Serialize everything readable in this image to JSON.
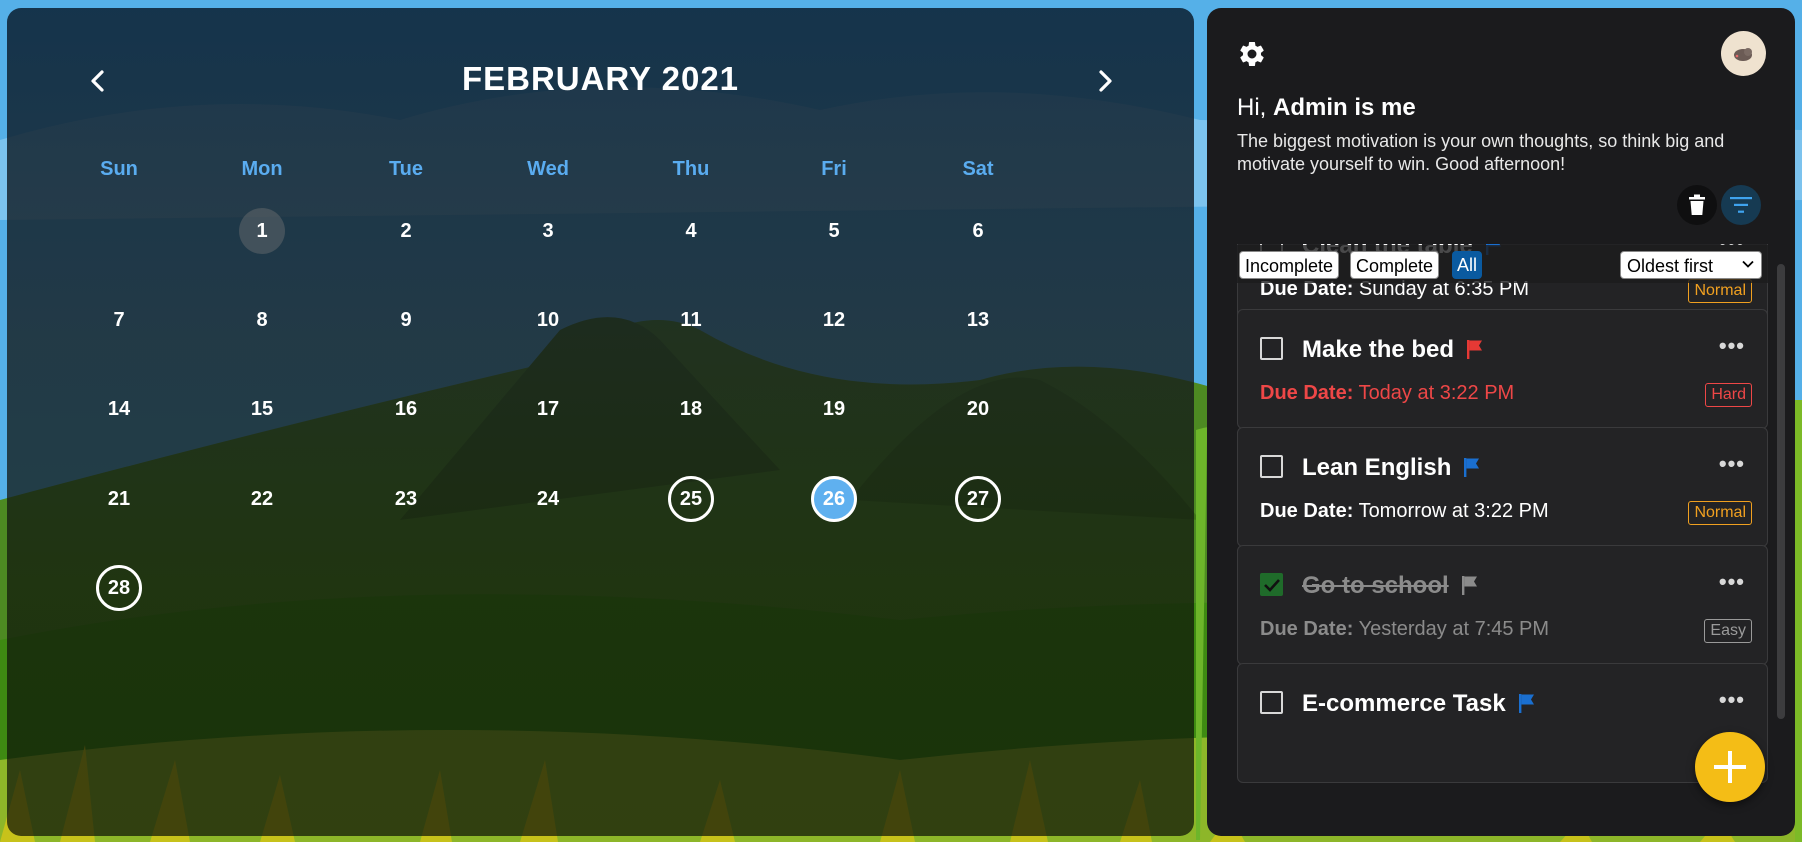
{
  "calendar": {
    "title": "FEBRUARY 2021",
    "prev_icon": "chevron-left-icon",
    "next_icon": "chevron-right-icon",
    "weekdays": [
      "Sun",
      "Mon",
      "Tue",
      "Wed",
      "Thu",
      "Fri",
      "Sat"
    ],
    "weeks": [
      [
        "",
        "1",
        "2",
        "3",
        "4",
        "5",
        "6"
      ],
      [
        "7",
        "8",
        "9",
        "10",
        "11",
        "12",
        "13"
      ],
      [
        "14",
        "15",
        "16",
        "17",
        "18",
        "19",
        "20"
      ],
      [
        "21",
        "22",
        "23",
        "24",
        "25",
        "26",
        "27"
      ],
      [
        "28",
        "",
        "",
        "",
        "",
        "",
        ""
      ]
    ],
    "today": "1",
    "selected": "26",
    "outlined": [
      "25",
      "27",
      "28"
    ],
    "weekday_color": "#5aacf0",
    "selected_color": "#5fb0ef"
  },
  "panel": {
    "settings_icon": "gear-icon",
    "avatar_icon": "avatar-icon",
    "greeting_prefix": "Hi,",
    "user_name": "Admin is me",
    "quote": "The biggest motivation is your own thoughts, so think big and motivate yourself to win. Good afternoon!",
    "delete_icon": "trash-icon",
    "filter_icon": "filter-icon",
    "filter": {
      "options": [
        "Incomplete",
        "Complete",
        "All"
      ],
      "active": "All",
      "sort_value": "Oldest first"
    },
    "due_label": "Due Date:",
    "tasks": [
      {
        "title": "Clean the table",
        "due": "Sunday at 6:35 PM",
        "level": "Normal",
        "flag_color": "#1a6fd0",
        "done": false,
        "state": "normal"
      },
      {
        "title": "Make the bed",
        "due": "Today at 3:22 PM",
        "level": "Hard",
        "flag_color": "#e53935",
        "done": false,
        "state": "overdue"
      },
      {
        "title": "Lean English",
        "due": "Tomorrow at 3:22 PM",
        "level": "Normal",
        "flag_color": "#1a6fd0",
        "done": false,
        "state": "normal"
      },
      {
        "title": "Go to school",
        "due": "Yesterday at 7:45 PM",
        "level": "Easy",
        "flag_color": "#8b8b8b",
        "done": true,
        "state": "done"
      },
      {
        "title": "E-commerce Task",
        "due": "",
        "level": "",
        "flag_color": "#1a6fd0",
        "done": false,
        "state": "normal"
      }
    ],
    "add_icon": "plus-icon",
    "add_color": "#f4bd16"
  }
}
